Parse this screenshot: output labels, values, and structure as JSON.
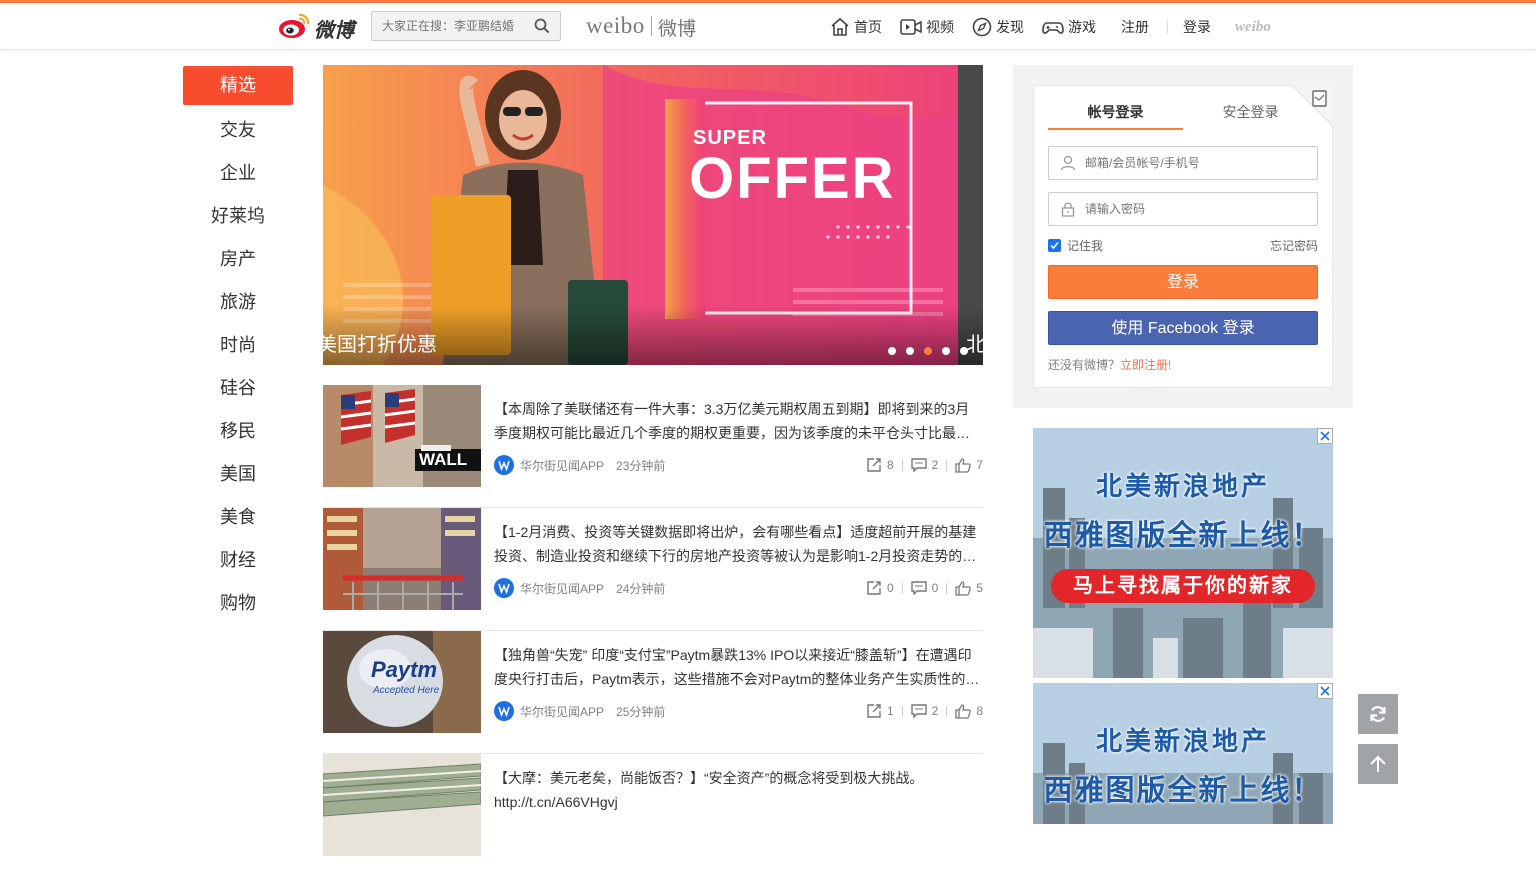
{
  "header": {
    "logo_text": "微博",
    "search_placeholder": "大家正在搜：李亚鹏结婚",
    "brand_en": "weibo",
    "brand_cn": "微博",
    "nav": [
      {
        "label": "首页",
        "icon": "home-icon"
      },
      {
        "label": "视频",
        "icon": "video-icon"
      },
      {
        "label": "发现",
        "icon": "discover-icon"
      },
      {
        "label": "游戏",
        "icon": "game-icon"
      }
    ],
    "register": "注册",
    "login": "登录",
    "weibo_small_logo": "weibo"
  },
  "sidebar": {
    "items": [
      "精选",
      "交友",
      "企业",
      "好莱坞",
      "房产",
      "旅游",
      "时尚",
      "硅谷",
      "移民",
      "美国",
      "美食",
      "财经",
      "购物"
    ],
    "active_index": 0
  },
  "banner": {
    "caption": "美国打折优惠",
    "next_caption": "北",
    "offer_small": "SUPER",
    "offer_big": "OFFER",
    "dot_count": 5,
    "active_dot": 2
  },
  "feed": [
    {
      "text": "【本周除了美联储还有一件大事：3.3万亿美元期权周五到期】即将到来的3月季度期权可能比最近几个季度的期权更重要，因为该季度的未平仓头寸比最…",
      "source": "华尔街见闻APP",
      "time": "23分钟前",
      "reposts": "8",
      "comments": "2",
      "likes": "7",
      "thumb": "wall-street-flags"
    },
    {
      "text": "【1-2月消费、投资等关键数据即将出炉，会有哪些看点】适度超前开展的基建投资、制造业投资和继续下行的房地产投资等被认为是影响1-2月投资走势的…",
      "source": "华尔街见闻APP",
      "time": "24分钟前",
      "reposts": "0",
      "comments": "0",
      "likes": "5",
      "thumb": "shopping-cart-aisle"
    },
    {
      "text": "【独角兽“失宠” 印度“支付宝”Paytm暴跌13% IPO以来接近“膝盖斩”】在遭遇印度央行打击后，Paytm表示，这些措施不会对Paytm的整体业务产生实质性的…",
      "source": "华尔街见闻APP",
      "time": "25分钟前",
      "reposts": "1",
      "comments": "2",
      "likes": "8",
      "thumb": "paytm-balloon"
    },
    {
      "text": "【大摩：美元老矣，尚能饭否？】“安全资产”的概念将受到极大挑战。http://t.cn/A66VHgvj",
      "thumb": "dollar-bills"
    }
  ],
  "login": {
    "tab_account": "帐号登录",
    "tab_secure": "安全登录",
    "username_placeholder": "邮箱/会员帐号/手机号",
    "password_placeholder": "请输入密码",
    "remember": "记住我",
    "forgot": "忘记密码",
    "login_button": "登录",
    "facebook_button": "使用 Facebook 登录",
    "no_account": "还没有微博？",
    "register_now": "立即注册!"
  },
  "ads": [
    {
      "line1": "北美新浪地产",
      "line2": "西雅图版全新上线！",
      "line3": "马上寻找属于你的新家"
    },
    {
      "line1": "北美新浪地产",
      "line2": "西雅图版全新上线！"
    }
  ],
  "colors": {
    "accent": "#fa7d3c",
    "active_nav": "#f74d2e",
    "facebook": "#4a64b0",
    "link": "#eb7350"
  }
}
